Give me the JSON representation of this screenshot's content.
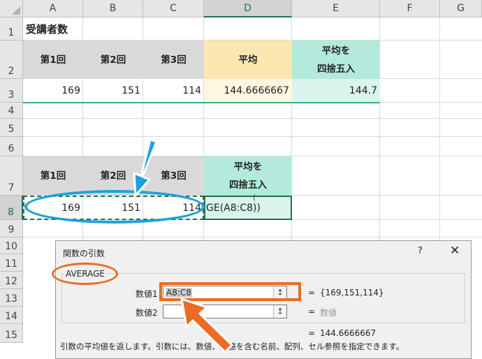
{
  "columns": [
    "A",
    "B",
    "C",
    "D",
    "E",
    "F",
    "G"
  ],
  "rows": [
    "1",
    "2",
    "3",
    "4",
    "5",
    "6",
    "7",
    "8",
    "9",
    "10",
    "11",
    "12",
    "13",
    "14",
    "15"
  ],
  "sheet": {
    "title": "受講者数",
    "table1": {
      "headers": [
        "第1回",
        "第2回",
        "第3回",
        "平均",
        "平均を\n四捨五入"
      ],
      "values": [
        "169",
        "151",
        "114",
        "144.6666667",
        "144.7"
      ]
    },
    "table2": {
      "headers": [
        "第1回",
        "第2回",
        "第3回",
        "平均を\n四捨五入"
      ],
      "values": [
        "169",
        "151",
        "114"
      ],
      "formula_fragment": "GE(A8:C8))",
      "formula_tail": "("
    }
  },
  "dialog": {
    "title": "関数の引数",
    "help": "?",
    "close": "✕",
    "function_name": "AVERAGE",
    "arg1_label": "数値1",
    "arg1_value": "A8:C8",
    "arg1_result": "{169,151,114}",
    "arg2_label": "数値2",
    "arg2_value": "",
    "arg2_result": "数値",
    "equals": "=",
    "formula_result": "144.6666667",
    "description": "引数の平均値を返します。引数には、数値、数値を含む名前、配列、セル参照を指定できます。",
    "ref_icon": "↥"
  },
  "colors": {
    "accent_orange": "#ec6b23",
    "accent_blue": "#1ea1dd",
    "excel_green": "#217346"
  }
}
